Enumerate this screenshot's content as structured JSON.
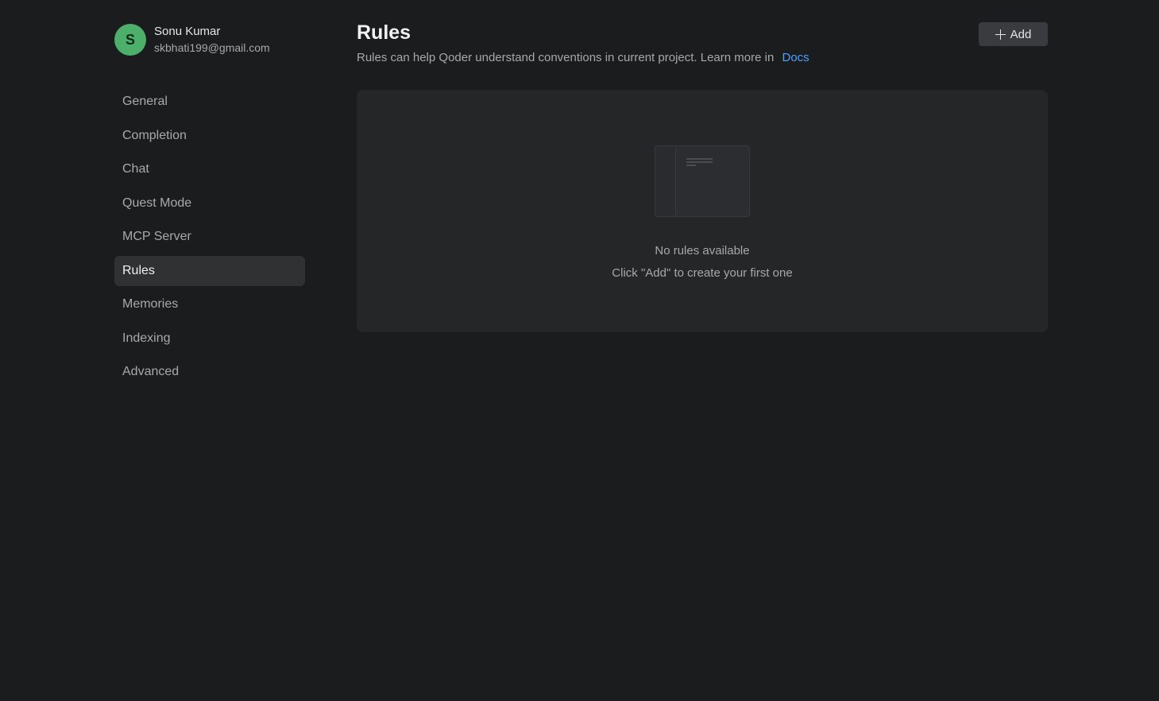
{
  "user": {
    "initial": "S",
    "name": "Sonu Kumar",
    "email": "skbhati199@gmail.com"
  },
  "sidebar": {
    "items": [
      {
        "label": "General"
      },
      {
        "label": "Completion"
      },
      {
        "label": "Chat"
      },
      {
        "label": "Quest Mode"
      },
      {
        "label": "MCP Server"
      },
      {
        "label": "Rules"
      },
      {
        "label": "Memories"
      },
      {
        "label": "Indexing"
      },
      {
        "label": "Advanced"
      }
    ],
    "active": "Rules"
  },
  "main": {
    "title": "Rules",
    "description": "Rules can help Qoder understand conventions in current project. Learn more in",
    "docs_link": "Docs",
    "add_label": "Add",
    "empty_title": "No rules available",
    "empty_hint": "Click \"Add\" to create your first one"
  },
  "colors": {
    "background": "#1b1c1e",
    "panel": "#252628",
    "avatar": "#4caf6a",
    "link": "#4da3ff",
    "active_item": "#303133"
  },
  "icons": {
    "add": "plus-icon",
    "empty": "empty-document-icon"
  }
}
